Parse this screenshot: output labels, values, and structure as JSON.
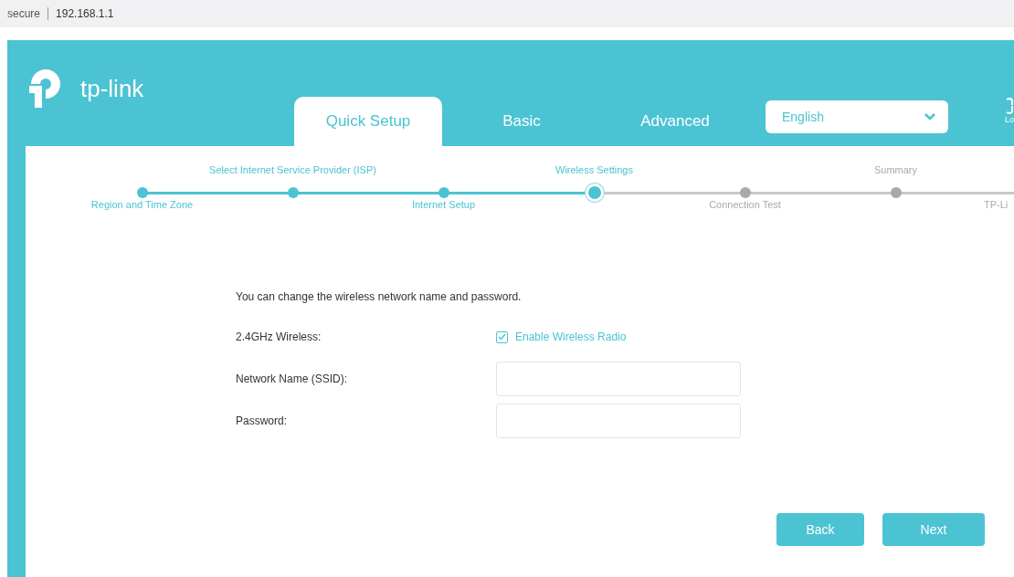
{
  "address_bar": {
    "security": "secure",
    "url": "192.168.1.1"
  },
  "header": {
    "logo": "tp-link",
    "tabs": [
      {
        "label": "Quick Setup",
        "selected": true
      },
      {
        "label": "Basic",
        "selected": false
      },
      {
        "label": "Advanced",
        "selected": false
      }
    ],
    "language": "English",
    "logout_label": "Lo"
  },
  "steps": [
    {
      "label": "Region and Time Zone",
      "done": true,
      "current": false
    },
    {
      "label": "Select Internet Service Provider (ISP)",
      "done": true,
      "current": false
    },
    {
      "label": "Internet Setup",
      "done": true,
      "current": false
    },
    {
      "label": "Wireless Settings",
      "done": false,
      "current": true
    },
    {
      "label": "Connection Test",
      "done": false,
      "current": false
    },
    {
      "label": "Summary",
      "done": false,
      "current": false
    },
    {
      "label": "TP-Li",
      "done": false,
      "current": false
    }
  ],
  "form": {
    "intro": "You can change the wireless network name and password.",
    "wireless_label": "2.4GHz Wireless:",
    "enable_radio": {
      "label": "Enable Wireless Radio",
      "checked": true
    },
    "fields": [
      {
        "label": "Network Name (SSID):"
      },
      {
        "label": "Password:"
      }
    ]
  },
  "buttons": [
    "Back",
    "Next"
  ]
}
